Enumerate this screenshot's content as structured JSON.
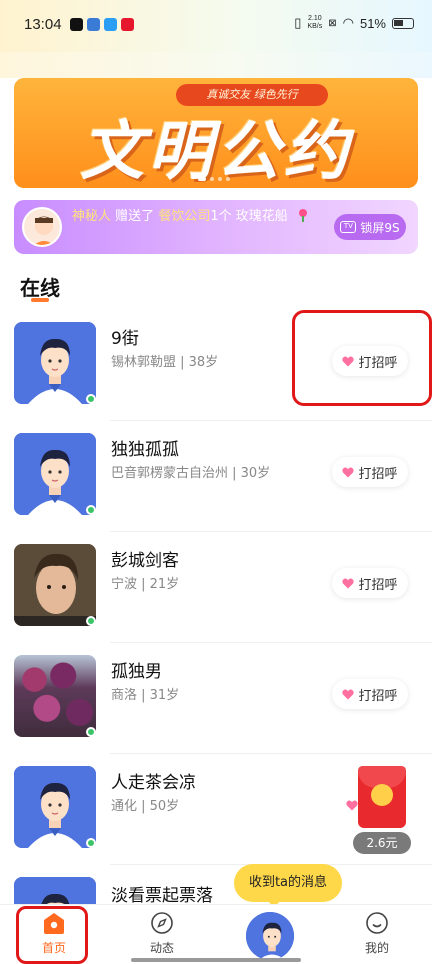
{
  "status_bar": {
    "time": "13:04",
    "net_speed_value": "2.10",
    "net_speed_unit": "KB/s",
    "battery": "51%"
  },
  "banner": {
    "tag": "真诚交友 绿色先行",
    "title": "文明公约",
    "dots_total": 4,
    "dot_active": 1
  },
  "notice": {
    "sender": "神秘人",
    "verb": "赠送了",
    "target": "餐饮公司",
    "gift": "1个 玫瑰花船",
    "lock_label": "锁屏9S"
  },
  "section": {
    "title": "在线"
  },
  "greet_label": "打招呼",
  "users": [
    {
      "name": "9街",
      "meta": "锡林郭勒盟 | 38岁",
      "avatar": "cartoon-avatar"
    },
    {
      "name": "独独孤孤",
      "meta": "巴音郭楞蒙古自治州 | 30岁",
      "avatar": "cartoon-avatar"
    },
    {
      "name": "彭城剑客",
      "meta": "宁波 | 21岁",
      "avatar": "photo"
    },
    {
      "name": "孤独男",
      "meta": "商洛 | 31岁",
      "avatar": "flower-photo"
    },
    {
      "name": "人走茶会凉",
      "meta": "通化 | 50岁",
      "avatar": "cartoon-avatar"
    },
    {
      "name": "淡看票起票落",
      "meta": "",
      "avatar": "cartoon-avatar"
    }
  ],
  "red_packet": {
    "amount": "2.6元"
  },
  "toast": {
    "text": "收到ta的消息"
  },
  "tabs": {
    "home": "首页",
    "feed": "动态",
    "mine": "我的"
  },
  "colors": {
    "accent": "#ff6a1f",
    "banner": "#ff9a22",
    "notice": "#d7a2ff",
    "online": "#3cc46b",
    "annotation": "#e01818"
  }
}
